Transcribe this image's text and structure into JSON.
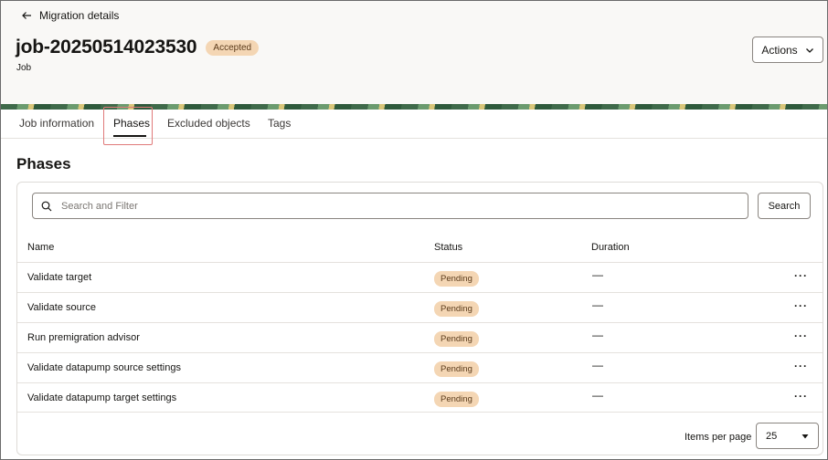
{
  "header": {
    "back_label": "Migration details",
    "title": "job-20250514023530",
    "status_badge": "Accepted",
    "subtitle": "Job",
    "actions_label": "Actions"
  },
  "tabs": [
    {
      "label": "Job information",
      "active": false
    },
    {
      "label": "Phases",
      "active": true
    },
    {
      "label": "Excluded objects",
      "active": false
    },
    {
      "label": "Tags",
      "active": false
    }
  ],
  "section_title": "Phases",
  "search": {
    "placeholder": "Search and Filter",
    "value": "",
    "button_label": "Search"
  },
  "table": {
    "columns": [
      "Name",
      "Status",
      "Duration"
    ],
    "rows": [
      {
        "name": "Validate target",
        "status": "Pending",
        "duration": "—"
      },
      {
        "name": "Validate source",
        "status": "Pending",
        "duration": "—"
      },
      {
        "name": "Run premigration advisor",
        "status": "Pending",
        "duration": "—"
      },
      {
        "name": "Validate datapump source settings",
        "status": "Pending",
        "duration": "—"
      },
      {
        "name": "Validate datapump target settings",
        "status": "Pending",
        "duration": "—"
      }
    ],
    "row_action_icon": "more-horizontal-icon"
  },
  "pagination": {
    "items_per_page_label": "Items per page",
    "items_per_page_value": "25"
  },
  "colors": {
    "badge_bg": "#f4d6b4",
    "header_bg": "#f9f8f6",
    "highlight_border": "#e07a7a"
  }
}
